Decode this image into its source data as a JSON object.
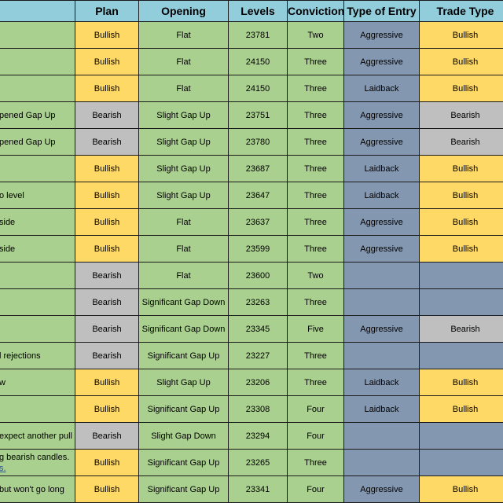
{
  "headers": [
    "",
    "Plan",
    "Opening",
    "Levels",
    "Conviction",
    "Type of Entry",
    "Trade Type"
  ],
  "colors": {
    "header": "#92cddc",
    "green": "#a9d08e",
    "yellow": "#ffd966",
    "gray": "#bfbfbf",
    "blue": "#8497b0"
  },
  "rows": [
    {
      "note": "",
      "plan": "Bullish",
      "opening": "Flat",
      "level": "23781",
      "conviction": "Two",
      "entry": "Aggressive",
      "trade": "Bullish"
    },
    {
      "note": "",
      "plan": "Bullish",
      "opening": "Flat",
      "level": "24150",
      "conviction": "Three",
      "entry": "Aggressive",
      "trade": "Bullish"
    },
    {
      "note": "",
      "plan": "Bullish",
      "opening": "Flat",
      "level": "24150",
      "conviction": "Three",
      "entry": "Laidback",
      "trade": "Bullish"
    },
    {
      "note": "pened Gap Up",
      "plan": "Bearish",
      "opening": "Slight Gap Up",
      "level": "23751",
      "conviction": "Three",
      "entry": "Aggressive",
      "trade": "Bearish"
    },
    {
      "note": "pened Gap Up",
      "plan": "Bearish",
      "opening": "Slight Gap Up",
      "level": "23780",
      "conviction": "Three",
      "entry": "Aggressive",
      "trade": "Bearish"
    },
    {
      "note": "",
      "plan": "Bullish",
      "opening": "Slight Gap Up",
      "level": "23687",
      "conviction": "Three",
      "entry": "Laidback",
      "trade": "Bullish"
    },
    {
      "note": "o level",
      "plan": "Bullish",
      "opening": "Slight Gap Up",
      "level": "23647",
      "conviction": "Three",
      "entry": "Laidback",
      "trade": "Bullish"
    },
    {
      "note": "side",
      "plan": "Bullish",
      "opening": "Flat",
      "level": "23637",
      "conviction": "Three",
      "entry": "Aggressive",
      "trade": "Bullish"
    },
    {
      "note": "side",
      "plan": "Bullish",
      "opening": "Flat",
      "level": "23599",
      "conviction": "Three",
      "entry": "Aggressive",
      "trade": "Bullish"
    },
    {
      "note": "",
      "plan": "Bearish",
      "opening": "Flat",
      "level": "23600",
      "conviction": "Two",
      "entry": "",
      "trade": ""
    },
    {
      "note": "",
      "plan": "Bearish",
      "opening": "Significant Gap Down",
      "level": "23263",
      "conviction": "Three",
      "entry": "",
      "trade": ""
    },
    {
      "note": "",
      "plan": "Bearish",
      "opening": "Significant Gap Down",
      "level": "23345",
      "conviction": "Five",
      "entry": "Aggressive",
      "trade": "Bearish"
    },
    {
      "note": "l rejections",
      "plan": "Bearish",
      "opening": "Significant Gap Up",
      "level": "23227",
      "conviction": "Three",
      "entry": "",
      "trade": ""
    },
    {
      "note": "w",
      "plan": "Bullish",
      "opening": "Slight Gap Up",
      "level": "23206",
      "conviction": "Three",
      "entry": "Laidback",
      "trade": "Bullish"
    },
    {
      "note": "",
      "plan": "Bullish",
      "opening": "Significant Gap Up",
      "level": "23308",
      "conviction": "Four",
      "entry": "Laidback",
      "trade": "Bullish"
    },
    {
      "note": "expect another pull",
      "plan": "Bearish",
      "opening": "Slight Gap Down",
      "level": "23294",
      "conviction": "Four",
      "entry": "",
      "trade": ""
    },
    {
      "note": "g bearish candles.",
      "note2": "s.",
      "plan": "Bullish",
      "opening": "Significant Gap Up",
      "level": "23265",
      "conviction": "Three",
      "entry": "",
      "trade": ""
    },
    {
      "note": " but won't go long",
      "plan": "Bullish",
      "opening": "Significant Gap Up",
      "level": "23341",
      "conviction": "Four",
      "entry": "Aggressive",
      "trade": "Bullish"
    }
  ]
}
